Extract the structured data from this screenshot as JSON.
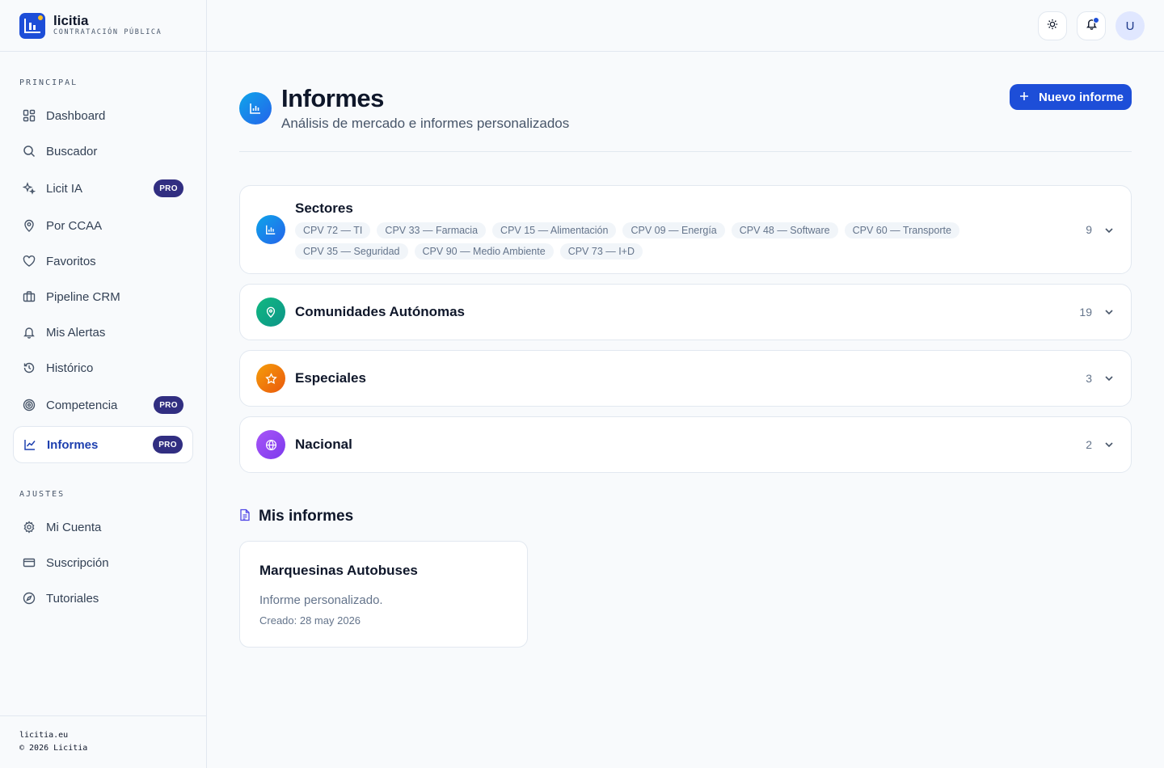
{
  "brand": {
    "name": "licitia",
    "tagline": "CONTRATACIÓN PÚBLICA"
  },
  "sidebar": {
    "section_principal": "PRINCIPAL",
    "section_ajustes": "AJUSTES",
    "items": [
      {
        "label": "Dashboard",
        "icon": "grid-icon"
      },
      {
        "label": "Buscador",
        "icon": "search-icon"
      },
      {
        "label": "Licit IA",
        "icon": "sparkles-icon",
        "badge": "PRO"
      },
      {
        "label": "Por CCAA",
        "icon": "map-pin-icon"
      },
      {
        "label": "Favoritos",
        "icon": "heart-icon"
      },
      {
        "label": "Pipeline CRM",
        "icon": "briefcase-icon"
      },
      {
        "label": "Mis Alertas",
        "icon": "bell-icon"
      },
      {
        "label": "Histórico",
        "icon": "history-icon"
      },
      {
        "label": "Competencia",
        "icon": "target-icon",
        "badge": "PRO"
      },
      {
        "label": "Informes",
        "icon": "chart-line-icon",
        "badge": "PRO",
        "active": true
      }
    ],
    "settings": [
      {
        "label": "Mi Cuenta",
        "icon": "gear-icon"
      },
      {
        "label": "Suscripción",
        "icon": "credit-card-icon"
      },
      {
        "label": "Tutoriales",
        "icon": "compass-icon"
      }
    ],
    "footer_line1": "licitia.eu",
    "footer_line2": "© 2026 Licitia"
  },
  "topbar": {
    "avatar_initial": "U"
  },
  "page": {
    "title": "Informes",
    "subtitle": "Análisis de mercado e informes personalizados",
    "new_button": "Nuevo informe"
  },
  "groups": [
    {
      "title": "Sectores",
      "count": "9",
      "chips": [
        "CPV 72 — TI",
        "CPV 33 — Farmacia",
        "CPV 15 — Alimentación",
        "CPV 09 — Energía",
        "CPV 48 — Software",
        "CPV 60 — Transporte",
        "CPV 35 — Seguridad",
        "CPV 90 — Medio Ambiente",
        "CPV 73 — I+D"
      ]
    },
    {
      "title": "Comunidades Autónomas",
      "count": "19"
    },
    {
      "title": "Especiales",
      "count": "3"
    },
    {
      "title": "Nacional",
      "count": "2"
    }
  ],
  "mis_informes": {
    "title": "Mis informes",
    "reports": [
      {
        "title": "Marquesinas Autobuses",
        "description": "Informe personalizado.",
        "created": "Creado: 28 may 2026"
      }
    ]
  },
  "colors": {
    "accent": "#1d4ed8",
    "pro_badge": "#312e81",
    "sectores": "#0ea5e9",
    "ccaa": "#10b981",
    "especiales": "#f97316",
    "nacional": "#8b5cf6"
  }
}
